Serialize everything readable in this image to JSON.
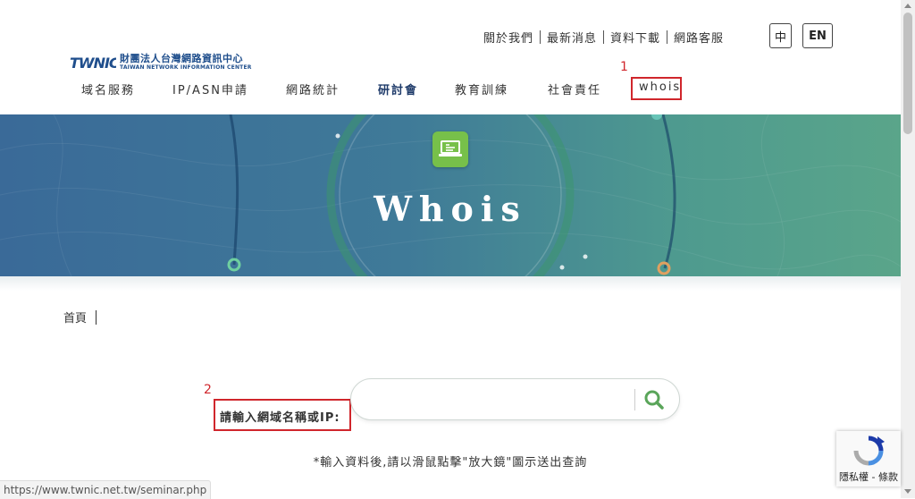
{
  "header": {
    "util_links": [
      "關於我們",
      "最新消息",
      "資料下載",
      "網路客服"
    ],
    "lang_zh": "中",
    "lang_en": "EN",
    "logo": {
      "mark": "TWNIC",
      "name_zh": "財團法人台灣網路資訊中心",
      "name_en": "TAIWAN NETWORK INFORMATION CENTER"
    }
  },
  "nav": {
    "items": [
      {
        "label": "域名服務"
      },
      {
        "label": "IP/ASN申請"
      },
      {
        "label": "網路統計"
      },
      {
        "label": "研討會",
        "active": true
      },
      {
        "label": "教育訓練"
      },
      {
        "label": "社會責任"
      },
      {
        "label": "whois"
      }
    ]
  },
  "annotations": {
    "marker_1": "1",
    "marker_2": "2",
    "color": "#d0262c"
  },
  "banner": {
    "title": "Whois",
    "icon": "laptop-icon",
    "colors": {
      "left": "#3a6a98",
      "right": "#5aa58a",
      "icon_bg": "#77c04a"
    }
  },
  "breadcrumb": {
    "home": "首頁"
  },
  "search": {
    "label": "請輸入網域名稱或IP:",
    "value": "",
    "placeholder": "",
    "button_icon": "search-icon",
    "accent": "#5aa55a",
    "hint": "*輸入資料後,請以滑鼠點擊\"放大鏡\"圖示送出查詢"
  },
  "status_bar": {
    "url": "https://www.twnic.net.tw/seminar.php"
  },
  "recaptcha": {
    "text": "隱私權 - 條款"
  }
}
